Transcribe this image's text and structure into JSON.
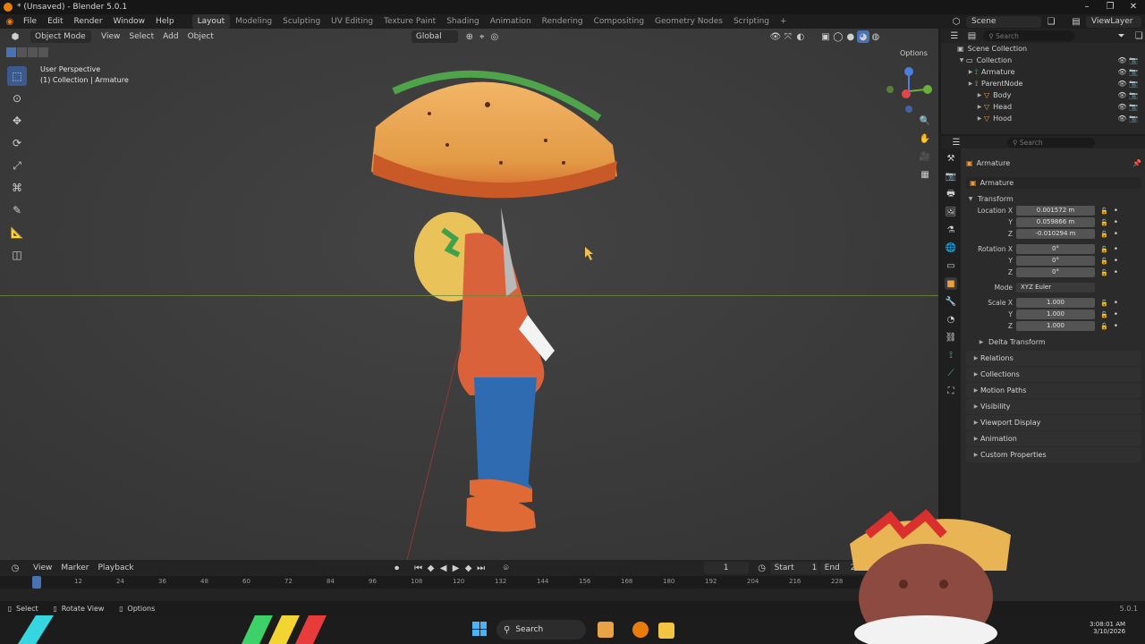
{
  "window": {
    "title": "* (Unsaved) - Blender 5.0.1"
  },
  "menu": [
    "File",
    "Edit",
    "Render",
    "Window",
    "Help"
  ],
  "workspaces": [
    "Layout",
    "Modeling",
    "Sculpting",
    "UV Editing",
    "Texture Paint",
    "Shading",
    "Animation",
    "Rendering",
    "Compositing",
    "Geometry Nodes",
    "Scripting"
  ],
  "active_workspace": "Layout",
  "scene": {
    "name": "Scene",
    "view_layer": "ViewLayer"
  },
  "viewport": {
    "mode": "Object Mode",
    "menus": [
      "View",
      "Select",
      "Add",
      "Object"
    ],
    "orientation": "Global",
    "options_label": "Options",
    "overlay_title": "User Perspective",
    "overlay_sub": "(1) Collection | Armature"
  },
  "outliner": {
    "search_placeholder": "Search",
    "items": [
      {
        "label": "Scene Collection",
        "indent": 0
      },
      {
        "label": "Collection",
        "indent": 1
      },
      {
        "label": "Armature",
        "indent": 2
      },
      {
        "label": "ParentNode",
        "indent": 2
      },
      {
        "label": "Body",
        "indent": 3
      },
      {
        "label": "Head",
        "indent": 3
      },
      {
        "label": "Hood",
        "indent": 3
      }
    ]
  },
  "properties": {
    "search_placeholder": "Search",
    "object_name": "Armature",
    "data_name": "Armature",
    "transform_label": "Transform",
    "location": [
      {
        "label": "Location X",
        "value": "0.001572 m"
      },
      {
        "label": "Y",
        "value": "0.059866 m"
      },
      {
        "label": "Z",
        "value": "-0.010294 m"
      }
    ],
    "rotation": [
      {
        "label": "Rotation X",
        "value": "0°"
      },
      {
        "label": "Y",
        "value": "0°"
      },
      {
        "label": "Z",
        "value": "0°"
      }
    ],
    "mode_label": "Mode",
    "mode_value": "XYZ Euler",
    "scale": [
      {
        "label": "Scale X",
        "value": "1.000"
      },
      {
        "label": "Y",
        "value": "1.000"
      },
      {
        "label": "Z",
        "value": "1.000"
      }
    ],
    "delta_label": "Delta Transform",
    "sections": [
      "Relations",
      "Collections",
      "Motion Paths",
      "Visibility",
      "Viewport Display",
      "Animation",
      "Custom Properties"
    ]
  },
  "timeline": {
    "menus": [
      "View",
      "Marker",
      "Playback"
    ],
    "current_frame": "1",
    "start_label": "Start",
    "start_value": "1",
    "end_label": "End",
    "end_value": "250",
    "ticks": [
      "1",
      "12",
      "24",
      "36",
      "48",
      "60",
      "72",
      "84",
      "96",
      "108",
      "120",
      "132",
      "144",
      "156",
      "168",
      "180",
      "192",
      "204",
      "216",
      "228"
    ]
  },
  "status": {
    "select": "Select",
    "rotate": "Rotate View",
    "options": "Options",
    "version": "5.0.1"
  },
  "taskbar": {
    "search": "Search",
    "time": "3:08:01 AM",
    "date": "3/10/2026"
  },
  "colors": {
    "accent": "#4772b3",
    "viewport_bg": "#3c3c3c",
    "panel_bg": "#2b2b2b",
    "orange": "#e87d0d"
  }
}
